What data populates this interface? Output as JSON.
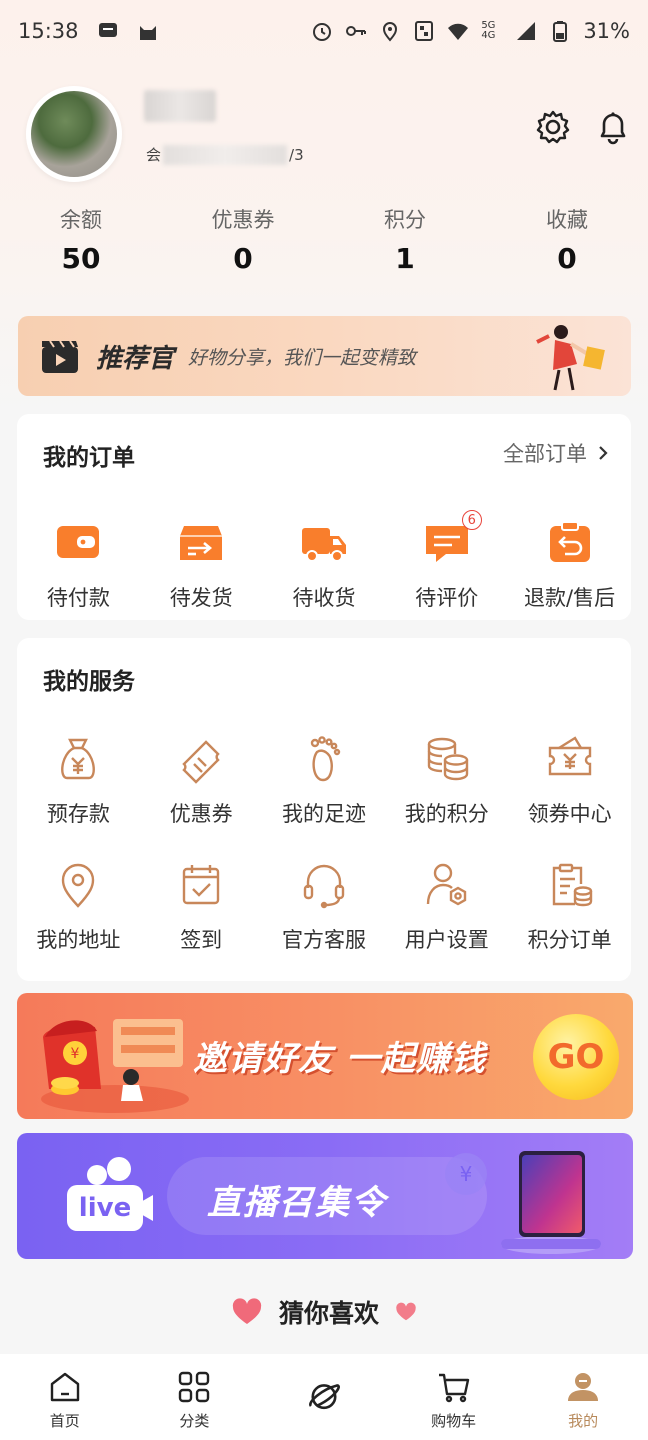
{
  "status_bar": {
    "time": "15:38",
    "network": "5G 4G",
    "battery": "31%"
  },
  "profile": {
    "member_suffix": "/3",
    "member_prefix": "会"
  },
  "stats": [
    {
      "label": "余额",
      "value": "50"
    },
    {
      "label": "优惠券",
      "value": "0"
    },
    {
      "label": "积分",
      "value": "1"
    },
    {
      "label": "收藏",
      "value": "0"
    }
  ],
  "recommend": {
    "title": "推荐官",
    "subtitle": "好物分享，我们一起变精致"
  },
  "orders": {
    "title": "我的订单",
    "all_label": "全部订单",
    "items": [
      {
        "label": "待付款",
        "icon": "wallet-icon"
      },
      {
        "label": "待发货",
        "icon": "shipping-box-icon"
      },
      {
        "label": "待收货",
        "icon": "delivery-truck-icon"
      },
      {
        "label": "待评价",
        "icon": "comment-icon",
        "badge": "6"
      },
      {
        "label": "退款/售后",
        "icon": "refund-icon"
      }
    ]
  },
  "services": {
    "title": "我的服务",
    "items": [
      {
        "label": "预存款",
        "icon": "money-bag-icon"
      },
      {
        "label": "优惠券",
        "icon": "coupon-icon"
      },
      {
        "label": "我的足迹",
        "icon": "footprint-icon"
      },
      {
        "label": "我的积分",
        "icon": "coins-icon"
      },
      {
        "label": "领券中心",
        "icon": "coupon-center-icon"
      },
      {
        "label": "我的地址",
        "icon": "location-icon"
      },
      {
        "label": "签到",
        "icon": "calendar-check-icon"
      },
      {
        "label": "官方客服",
        "icon": "headset-icon"
      },
      {
        "label": "用户设置",
        "icon": "user-settings-icon"
      },
      {
        "label": "积分订单",
        "icon": "points-order-icon"
      }
    ]
  },
  "invite_banner": {
    "text": "邀请好友 一起赚钱",
    "go": "GO"
  },
  "live_banner": {
    "text": "直播召集令",
    "badge": "live"
  },
  "guess": {
    "title": "猜你喜欢"
  },
  "tabbar": [
    {
      "label": "首页",
      "icon": "home-icon"
    },
    {
      "label": "分类",
      "icon": "grid-icon"
    },
    {
      "label": "",
      "icon": "planet-icon"
    },
    {
      "label": "购物车",
      "icon": "cart-icon"
    },
    {
      "label": "我的",
      "icon": "profile-icon",
      "active": true
    }
  ],
  "colors": {
    "accent_orange": "#f97e2c",
    "service_brown": "#c8875a",
    "active_tab": "#b88a5c"
  }
}
